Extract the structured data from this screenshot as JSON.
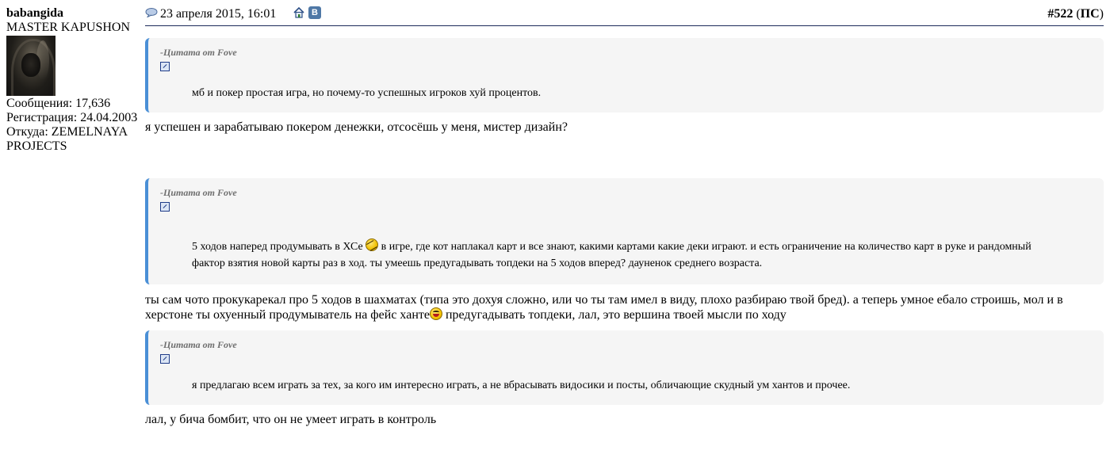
{
  "user": {
    "name": "babangida",
    "title": "MASTER KAPUSHON",
    "posts": "Сообщения: 17,636",
    "registered": "Регистрация: 24.04.2003",
    "location_line1": "Откуда: ZEMELNAYA",
    "location_line2": "PROJECTS"
  },
  "header": {
    "date": "23 апреля 2015, 16:01",
    "vk_label": "В",
    "post_number": "#522",
    "ps_label": "ПС"
  },
  "quotes": [
    {
      "title": "-Цитата от Fove",
      "text": "мб и покер простая игра, но почему-то успешных игроков хуй процентов."
    },
    {
      "title": "-Цитата от Fove",
      "text_before_smiley": "5 ходов наперед продумывать в ХСе ",
      "text_after_smiley": " в игре, где кот наплакал карт и все знают, какими картами какие деки играют. и есть ограничение на количество карт в руке и рандомный фактор взятия новой карты раз в ход. ты умеешь предугадывать топдеки на 5 ходов вперед? дауненок среднего возраста."
    },
    {
      "title": "-Цитата от Fove",
      "text": "я предлагаю всем играть за тех, за кого им интересно играть, а не вбрасывать видосики и посты, обличающие скудный ум хантов и прочее."
    }
  ],
  "replies": [
    {
      "text": "я успешен и зарабатываю покером денежки, отсосёшь у меня, мистер дизайн?"
    },
    {
      "text_before_smiley": "ты сам чото прокукарекал про 5 ходов в шахматах (типа это дохуя сложно, или чо ты там имел в виду, плохо разбираю твой бред). а теперь умное ебало строишь, мол и в херстоне ты охуенный продумыватель на фейс ханте",
      "text_after_smiley": " предугадывать топдеки, лал, это вершина твоей мысли по ходу"
    },
    {
      "text": "лал, у бича бомбит, что он не умеет играть в контроль"
    }
  ],
  "icons": {
    "post_icon": "speech-bubble-icon",
    "home_icon": "home-icon",
    "vk_icon": "vk-icon",
    "quote_link_icon": "go-to-post-icon",
    "smiley_1": "dizzy-smiley-icon",
    "smiley_2": "laughing-smiley-icon"
  },
  "colors": {
    "quote_border": "#4a8fd6",
    "quote_bg": "#f5f5f5",
    "header_line": "#1c2a5a",
    "vk_blue": "#4f78a6"
  }
}
